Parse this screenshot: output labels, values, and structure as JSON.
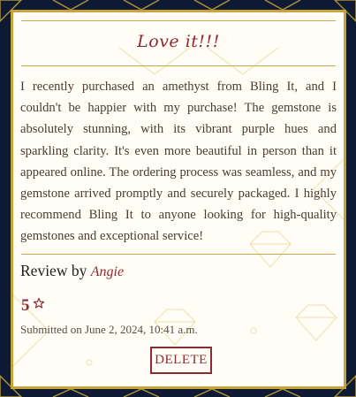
{
  "review": {
    "title": "Love it!!!",
    "body": "I recently purchased an amethyst from Bling It, and I couldn't be happier with my purchase! The gemstone is absolutely stunning, with its vibrant purple hues and sparkling clarity. It's even more beautiful in person than it appeared online. The ordering process was seamless, and my gemstone arrived promptly and securely packaged. I highly recommend Bling It to anyone looking for high-quality gemstones and exceptional service!",
    "review_by_label": "Review by",
    "reviewer": "Angie",
    "rating": "5",
    "submitted": "Submitted on June 2, 2024, 10:41 a.m.",
    "delete_label": "DELETE"
  },
  "icons": {
    "rating": "star-outline-icon"
  },
  "colors": {
    "page_background": "#0e1a33",
    "card_background": "#fffdf6",
    "gold_accent": "#c7a43a",
    "maroon_accent": "#8e2a33"
  }
}
